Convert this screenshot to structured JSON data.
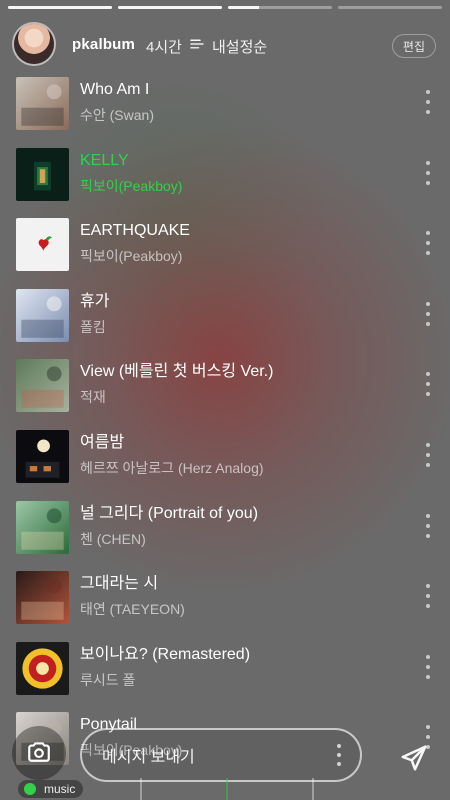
{
  "story": {
    "progress": [
      1,
      1,
      0.3,
      0
    ],
    "header": {
      "username": "pkalbum",
      "time_ago": "4시간",
      "sort_label": "내설정순",
      "edit_label": "편집"
    }
  },
  "songs": [
    {
      "title": "Who Am I",
      "artist": "수안 (Swan)",
      "art": "art-1"
    },
    {
      "title": "KELLY",
      "artist": "픽보이(Peakboy)",
      "art": "art-2",
      "active": true
    },
    {
      "title": "EARTHQUAKE",
      "artist": "픽보이(Peakboy)",
      "art": "art-3"
    },
    {
      "title": "휴가",
      "artist": "폴킴",
      "art": "art-4"
    },
    {
      "title": "View (베를린 첫 버스킹 Ver.)",
      "artist": "적재",
      "art": "art-5"
    },
    {
      "title": "여름밤",
      "artist": "헤르쯔 아날로그 (Herz Analog)",
      "art": "art-6"
    },
    {
      "title": "널 그리다 (Portrait of you)",
      "artist": "첸 (CHEN)",
      "art": "art-7"
    },
    {
      "title": "그대라는 시",
      "artist": "태연 (TAEYEON)",
      "art": "art-8"
    },
    {
      "title": "보이나요? (Remastered)",
      "artist": "루시드 폴",
      "art": "art-9"
    },
    {
      "title": "Ponytail",
      "artist": "픽보이(Peakboy)",
      "art": "art-10"
    }
  ],
  "composer": {
    "placeholder": "메시지 보내기",
    "music_label": "music"
  },
  "colors": {
    "accent": "#33d14a"
  },
  "icons": {
    "camera": "camera-icon",
    "send": "send-icon",
    "sort": "sort-icon",
    "more": "more-vertical-icon"
  }
}
